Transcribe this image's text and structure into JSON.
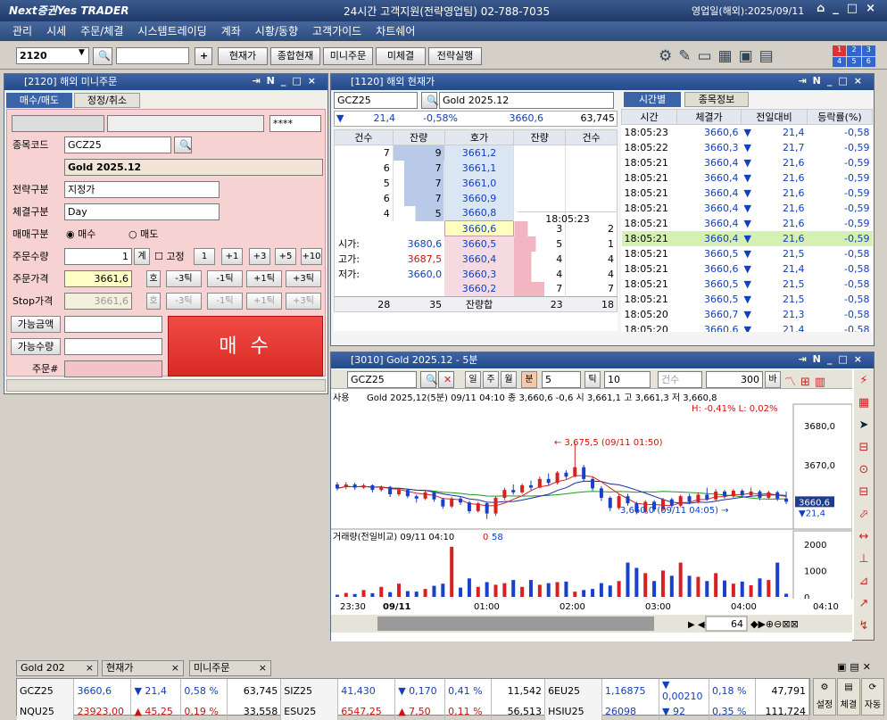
{
  "app": {
    "logo": "Next증권Yes TRADER",
    "support": "24시간 고객지원(전략영업팀) 02-788-7035",
    "biz_day": "영업일(해외):2025/09/11"
  },
  "menu": [
    "관리",
    "시세",
    "주문/체결",
    "시스템트레이딩",
    "계좌",
    "시황/동향",
    "고객가이드",
    "차트쉐어"
  ],
  "toolbar": {
    "screen_no": "2120",
    "buttons": [
      "현재가",
      "종합현재",
      "미니주문",
      "미체결",
      "전략실행"
    ]
  },
  "order": {
    "title": "[2120] 해외 미니주문",
    "tabs": [
      "매수/매도",
      "정정/취소"
    ],
    "password": "****",
    "code_label": "종목코드",
    "code": "GCZ25",
    "name": "Gold 2025.12",
    "strategy_label": "전략구분",
    "strategy": "지정가",
    "exec_label": "체결구분",
    "exec": "Day",
    "side_label": "매매구분",
    "buy": "매수",
    "sell": "매도",
    "qty_label": "주문수량",
    "qty": "1",
    "qty_btn": "계",
    "fixed": "고정",
    "qty_steps": [
      "1",
      "+1",
      "+3",
      "+5",
      "+10"
    ],
    "price_label": "주문가격",
    "price": "3661,6",
    "ho": "호",
    "ticks": [
      "-3틱",
      "-1틱",
      "+1틱",
      "+3틱"
    ],
    "stop_label": "Stop가격",
    "stop": "3661,6",
    "avail_amt": "가능금액",
    "avail_qty": "가능수량",
    "order_no": "주문#",
    "submit": "매 수"
  },
  "quote": {
    "title": "[1120] 해외 현재가",
    "code": "GCZ25",
    "name": "Gold 2025.12",
    "summary": {
      "chg": "21,4",
      "pct": "-0,58%",
      "price": "3660,6",
      "vol": "63,745"
    },
    "headers": [
      "건수",
      "잔량",
      "호가",
      "잔량",
      "건수"
    ],
    "asks": [
      {
        "cnt": "7",
        "qty": "9",
        "price": "3661,2"
      },
      {
        "cnt": "6",
        "qty": "7",
        "price": "3661,1"
      },
      {
        "cnt": "5",
        "qty": "7",
        "price": "3661,0"
      },
      {
        "cnt": "6",
        "qty": "7",
        "price": "3660,9"
      },
      {
        "cnt": "4",
        "qty": "5",
        "price": "3660,8"
      }
    ],
    "bids": [
      {
        "price": "3660,6",
        "qty": "3",
        "cnt": "2"
      },
      {
        "price": "3660,5",
        "qty": "5",
        "cnt": "1"
      },
      {
        "price": "3660,4",
        "qty": "4",
        "cnt": "4"
      },
      {
        "price": "3660,3",
        "qty": "4",
        "cnt": "4"
      },
      {
        "price": "3660,2",
        "qty": "7",
        "cnt": "7"
      }
    ],
    "time": "18:05:23",
    "ohl": [
      {
        "label": "시가:",
        "value": "3680,6"
      },
      {
        "label": "고가:",
        "value": "3687,5"
      },
      {
        "label": "저가:",
        "value": "3660,0"
      }
    ],
    "totals": {
      "ask_cnt": "28",
      "ask_qty": "35",
      "label": "잔량합",
      "bid_qty": "23",
      "bid_cnt": "18"
    },
    "tabs": [
      "시간별",
      "종목정보"
    ],
    "tick_headers": [
      "시간",
      "체결가",
      "전일대비",
      "등락률(%)"
    ],
    "ticks": [
      {
        "t": "18:05:23",
        "p": "3660,6",
        "c": "21,4",
        "r": "-0,58"
      },
      {
        "t": "18:05:22",
        "p": "3660,3",
        "c": "21,7",
        "r": "-0,59"
      },
      {
        "t": "18:05:21",
        "p": "3660,4",
        "c": "21,6",
        "r": "-0,59"
      },
      {
        "t": "18:05:21",
        "p": "3660,4",
        "c": "21,6",
        "r": "-0,59"
      },
      {
        "t": "18:05:21",
        "p": "3660,4",
        "c": "21,6",
        "r": "-0,59"
      },
      {
        "t": "18:05:21",
        "p": "3660,4",
        "c": "21,6",
        "r": "-0,59"
      },
      {
        "t": "18:05:21",
        "p": "3660,4",
        "c": "21,6",
        "r": "-0,59"
      },
      {
        "t": "18:05:21",
        "p": "3660,4",
        "c": "21,6",
        "r": "-0,59"
      },
      {
        "t": "18:05:21",
        "p": "3660,5",
        "c": "21,5",
        "r": "-0,58"
      },
      {
        "t": "18:05:21",
        "p": "3660,6",
        "c": "21,4",
        "r": "-0,58"
      },
      {
        "t": "18:05:21",
        "p": "3660,5",
        "c": "21,5",
        "r": "-0,58"
      },
      {
        "t": "18:05:21",
        "p": "3660,5",
        "c": "21,5",
        "r": "-0,58"
      },
      {
        "t": "18:05:20",
        "p": "3660,7",
        "c": "21,3",
        "r": "-0,58"
      },
      {
        "t": "18:05:20",
        "p": "3660,6",
        "c": "21,4",
        "r": "-0,58"
      }
    ]
  },
  "chart": {
    "title": "[3010] Gold 2025.12 - 5분",
    "code": "GCZ25",
    "periods": [
      "일",
      "주",
      "월",
      "분"
    ],
    "interval": "5",
    "tick_label": "틱",
    "tick": "10",
    "count_label": "건수",
    "count": "300",
    "bar": "바",
    "info": "Gold 2025,12(5분) 09/11 04:10  종 3,660,6  -0,6  시 3,661,1  고 3,661,3  저 3,660,8",
    "hl": "H: -0,41%   L: 0,02%",
    "price_axis": [
      "3680,0",
      "3670,0"
    ],
    "last": "3660,6",
    "last_chg": "21,4",
    "hi_note": "3,675,5 (09/11 01:50)",
    "lo_note": "3,660,0 (09/11 04:05)",
    "vol_title": "거래량(전일비교)  09/11 04:10",
    "vol_v1": "0",
    "vol_v2": "58",
    "vol_axis": [
      "2000",
      "1000",
      "0"
    ],
    "time_axis": [
      "23:30",
      "09/11",
      "01:00",
      "02:00",
      "03:00",
      "04:00",
      "04:10"
    ],
    "zoom": "64",
    "tag": "사용"
  },
  "bottom_tabs": [
    "Gold 202",
    "현재가",
    "미니주문"
  ],
  "tickers": [
    {
      "code": "GCZ25",
      "price": "3660,6",
      "dir": "dn",
      "chg": "21,4",
      "pct": "0,58 %",
      "vol": "63,745"
    },
    {
      "code": "SIZ25",
      "price": "41,430",
      "dir": "dn",
      "chg": "0,170",
      "pct": "0,41 %",
      "vol": "11,542"
    },
    {
      "code": "6EU25",
      "price": "1,16875",
      "dir": "dn",
      "chg": "0,00210",
      "pct": "0,18 %",
      "vol": "47,791"
    },
    {
      "code": "NQU25",
      "price": "23923,00",
      "dir": "up",
      "chg": "45,25",
      "pct": "0,19 %",
      "vol": "33,558"
    },
    {
      "code": "ESU25",
      "price": "6547,25",
      "dir": "up",
      "chg": "7,50",
      "pct": "0,11 %",
      "vol": "56,513"
    },
    {
      "code": "HSIU25",
      "price": "26098",
      "dir": "dn",
      "chg": "92",
      "pct": "0,35 %",
      "vol": "111,724"
    }
  ],
  "side_buttons": [
    "설정",
    "체결",
    "자동"
  ],
  "colors": {
    "ask_bg": "#dbe6f5",
    "bid_bg": "#f5dbe1",
    "order_bg": "#f7d4d4",
    "buy_btn": "#e8302c",
    "highlight": "#d6f0b4"
  },
  "chart_data": {
    "type": "candlestick",
    "ylim": [
      3655,
      3685
    ],
    "candles": [
      [
        3665,
        3664,
        3665.6,
        3663.5
      ],
      [
        3664.5,
        3665,
        3665.6,
        3663.8
      ],
      [
        3665,
        3664.2,
        3665.4,
        3663.6
      ],
      [
        3664.2,
        3664.8,
        3665.2,
        3663.9
      ],
      [
        3664.8,
        3663.6,
        3665,
        3663
      ],
      [
        3663.6,
        3664.4,
        3664.8,
        3663.2
      ],
      [
        3664.4,
        3662.5,
        3664.6,
        3661.8
      ],
      [
        3662.5,
        3663.6,
        3664,
        3662
      ],
      [
        3663.6,
        3662,
        3663.8,
        3661.5
      ],
      [
        3662,
        3661.4,
        3662.4,
        3660.4
      ],
      [
        3661.4,
        3663,
        3663.4,
        3661
      ],
      [
        3663,
        3661.2,
        3663.2,
        3660.6
      ],
      [
        3661.2,
        3659.4,
        3661.6,
        3658.8
      ],
      [
        3659.4,
        3661.4,
        3661.8,
        3659
      ],
      [
        3661.4,
        3660.4,
        3662,
        3659.8
      ],
      [
        3660.4,
        3658.2,
        3660.8,
        3657.6
      ],
      [
        3658.2,
        3660.2,
        3660.6,
        3657.8
      ],
      [
        3660.2,
        3657.6,
        3660.6,
        3656.2
      ],
      [
        3657.6,
        3661.6,
        3662,
        3657
      ],
      [
        3661.6,
        3663.6,
        3664.2,
        3661
      ],
      [
        3663.6,
        3663,
        3665,
        3662.4
      ],
      [
        3663,
        3664.8,
        3665.2,
        3662.6
      ],
      [
        3664.8,
        3664.2,
        3666,
        3663.6
      ],
      [
        3664.2,
        3666.4,
        3667,
        3664
      ],
      [
        3666.4,
        3665.4,
        3667.8,
        3664.8
      ],
      [
        3665.4,
        3668,
        3668.4,
        3665
      ],
      [
        3668,
        3667,
        3668.6,
        3666.4
      ],
      [
        3667,
        3669.4,
        3675.5,
        3666.8
      ],
      [
        3669.4,
        3666.4,
        3670,
        3665.8
      ],
      [
        3666.4,
        3664,
        3666.8,
        3663.4
      ],
      [
        3664,
        3661.6,
        3664.6,
        3660.8
      ],
      [
        3661.6,
        3659,
        3662,
        3658.2
      ],
      [
        3659,
        3662,
        3662.6,
        3658.6
      ],
      [
        3662,
        3660.2,
        3662.6,
        3659.6
      ],
      [
        3660.2,
        3658,
        3660.6,
        3657.4
      ],
      [
        3658,
        3660.6,
        3661,
        3657.6
      ],
      [
        3660.6,
        3658.6,
        3661,
        3658
      ],
      [
        3658.6,
        3661.2,
        3661.6,
        3658.2
      ],
      [
        3661.2,
        3659.6,
        3661.6,
        3659
      ],
      [
        3659.6,
        3662,
        3662.4,
        3659.2
      ],
      [
        3662,
        3660.6,
        3662.6,
        3660
      ],
      [
        3660.6,
        3662.4,
        3663,
        3660.2
      ],
      [
        3662.4,
        3661.2,
        3664.2,
        3660.8
      ],
      [
        3661.2,
        3663.2,
        3663.8,
        3660.8
      ],
      [
        3663.2,
        3662,
        3663.6,
        3661.4
      ],
      [
        3662,
        3663.4,
        3663.8,
        3661.6
      ],
      [
        3663.4,
        3662.2,
        3663.8,
        3661.6
      ],
      [
        3662.2,
        3663.2,
        3664.2,
        3661.8
      ],
      [
        3663.2,
        3661.6,
        3663.6,
        3661
      ],
      [
        3661.6,
        3663,
        3663.4,
        3661.2
      ],
      [
        3663,
        3661.4,
        3663.4,
        3660.8
      ],
      [
        3661.4,
        3660.6,
        3663.2,
        3660
      ]
    ],
    "volume": [
      80,
      150,
      110,
      260,
      140,
      380,
      180,
      500,
      220,
      200,
      300,
      420,
      500,
      1900,
      350,
      700,
      380,
      560,
      460,
      520,
      640,
      380,
      640,
      460,
      520,
      560,
      580,
      200,
      260,
      300,
      520,
      430,
      600,
      1300,
      1100,
      900,
      600,
      1000,
      800,
      1300,
      800,
      760,
      600,
      900,
      620,
      500,
      580,
      440,
      700,
      640,
      1300,
      120
    ]
  }
}
